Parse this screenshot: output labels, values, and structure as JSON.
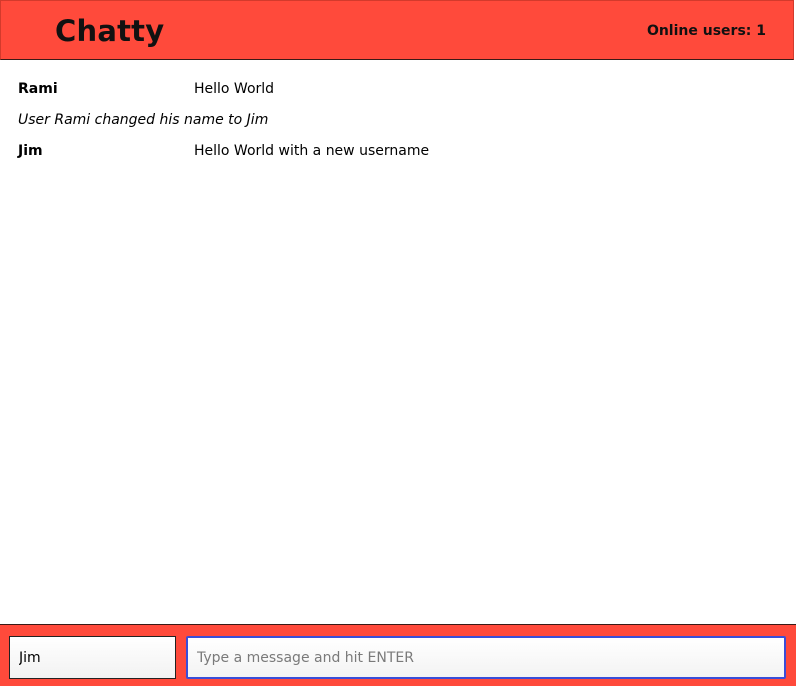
{
  "navbar": {
    "brand": "Chatty",
    "online_users": "Online users: 1"
  },
  "messages": [
    {
      "type": "message",
      "username": "Rami",
      "content": "Hello World"
    },
    {
      "type": "system",
      "content": "User Rami changed his name to Jim"
    },
    {
      "type": "message",
      "username": "Jim",
      "content": "Hello World with a new username"
    }
  ],
  "chatbar": {
    "username_value": "Jim",
    "message_placeholder": "Type a message and hit ENTER",
    "message_value": ""
  },
  "colors": {
    "accent": "#ff4a3b",
    "focus_border": "#3a4ed8"
  }
}
